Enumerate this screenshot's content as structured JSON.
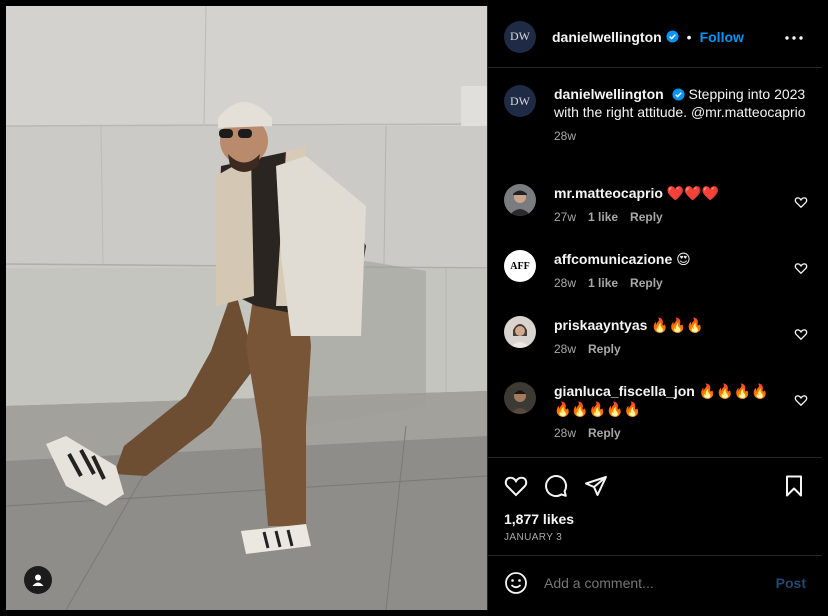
{
  "post": {
    "author": "danielwellington",
    "author_avatar_text": "DW",
    "follow_label": "Follow",
    "separator": "•",
    "caption": "Stepping into 2023 with the right attitude. @mr.matteocaprio",
    "caption_time": "28w"
  },
  "comments": [
    {
      "username": "mr.matteocaprio",
      "text": "❤️❤️❤️",
      "time": "27w",
      "likes": "1 like",
      "reply": "Reply"
    },
    {
      "username": "affcomunicazione",
      "text": "😍",
      "time": "28w",
      "likes": "1 like",
      "reply": "Reply",
      "avatar_text": "AFF"
    },
    {
      "username": "priskaayntyas",
      "text": "🔥🔥🔥",
      "time": "28w",
      "reply": "Reply"
    },
    {
      "username": "gianluca_fiscella_jon",
      "text": "🔥🔥🔥🔥 🔥🔥🔥🔥🔥",
      "time": "28w",
      "reply": "Reply"
    }
  ],
  "engagement": {
    "likes": "1,877 likes",
    "date": "JANUARY 3"
  },
  "composer": {
    "placeholder": "Add a comment...",
    "post_label": "Post"
  },
  "colors": {
    "accent": "#0095f6",
    "background": "#000000",
    "divider": "#262626",
    "muted": "#a8a8a8"
  }
}
